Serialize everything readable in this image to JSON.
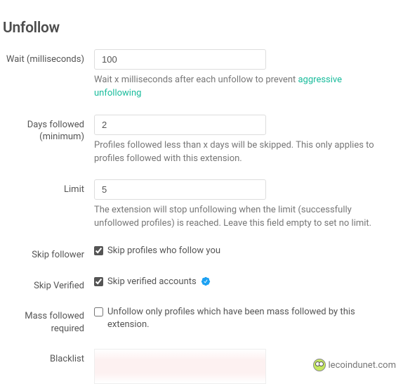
{
  "title": "Unfollow",
  "fields": {
    "wait": {
      "label": "Wait (milliseconds)",
      "value": "100",
      "help": "Wait x milliseconds after each unfollow to prevent ",
      "helpLink": "aggressive unfollowing"
    },
    "daysFollowed": {
      "label": "Days followed (minimum)",
      "value": "2",
      "help": "Profiles followed less than x days will be skipped. This only applies to profiles followed with this extension."
    },
    "limit": {
      "label": "Limit",
      "value": "5",
      "help": "The extension will stop unfollowing when the limit (successfully unfollowed profiles) is reached. Leave this field empty to set no limit."
    },
    "skipFollower": {
      "label": "Skip follower",
      "checkboxLabel": "Skip profiles who follow you",
      "checked": true
    },
    "skipVerified": {
      "label": "Skip Verified",
      "checkboxLabel": "Skip verified accounts",
      "checked": true
    },
    "massFollowed": {
      "label": "Mass followed required",
      "checkboxLabel": "Unfollow only profiles which have been mass followed by this extension.",
      "checked": false
    },
    "blacklist": {
      "label": "Blacklist"
    }
  },
  "watermark": "lecoindunet.com"
}
